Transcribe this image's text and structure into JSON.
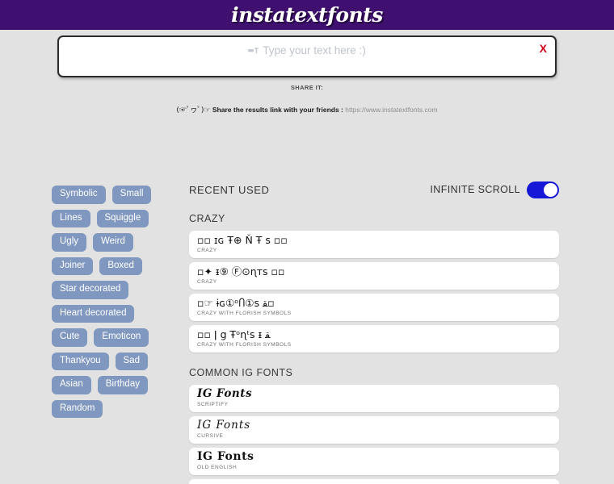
{
  "header": {
    "logo": "instatextfonts",
    "bg_color": "#3f1070"
  },
  "input": {
    "placeholder": "Type your text here :)",
    "value": "",
    "clear_label": "X",
    "clear_color": "#d0021b",
    "icon": "pencil-icon"
  },
  "share": {
    "title": "SHARE IT:",
    "emoticon": "(☞ﾟヮﾟ)☞",
    "message": "Share the results link with your friends :",
    "url": "https://www.instatextfonts.com"
  },
  "sidebar": {
    "tags": [
      {
        "label": "Symbolic"
      },
      {
        "label": "Small"
      },
      {
        "label": "Lines"
      },
      {
        "label": "Squiggle"
      },
      {
        "label": "Ugly"
      },
      {
        "label": "Weird"
      },
      {
        "label": "Joiner"
      },
      {
        "label": "Boxed"
      },
      {
        "label": "Star decorated"
      },
      {
        "label": "Heart decorated"
      },
      {
        "label": "Cute"
      },
      {
        "label": "Emoticon"
      },
      {
        "label": "Thankyou"
      },
      {
        "label": "Sad"
      },
      {
        "label": "Asian"
      },
      {
        "label": "Birthday"
      },
      {
        "label": "Random"
      }
    ],
    "tag_color": "#8098c0"
  },
  "main": {
    "recent_used_label": "RECENT USED",
    "infinite_scroll_label": "INFINITE SCROLL",
    "infinite_scroll_on": true,
    "toggle_color": "#1717d8",
    "groups": [
      {
        "label": "CRAZY",
        "cards": [
          {
            "sample": "▫▫ ɪɢ Ŧ⊕ Ň Ŧ s  ▫▫",
            "tag": "CRAZY",
            "style": "symbol"
          },
          {
            "sample": "▫✦ ᵻ⑨ Ⓕ⊙ɳᴛs ▫▫",
            "tag": "CRAZY",
            "style": "symbol"
          },
          {
            "sample": "▫☞ ɨɢ①ᵒႶ①s ﻘ▫",
            "tag": "CRAZY WITH FLORISH SYMBOLS",
            "style": "symbol"
          },
          {
            "sample": "▫▫ ǀ g Ŧᵒɳᵗs ᵻ ﻘ",
            "tag": "CRAZY WITH FLORISH SYMBOLS",
            "style": "symbol"
          }
        ]
      },
      {
        "label": "COMMON IG FONTS",
        "cards": [
          {
            "sample": "IG Fonts",
            "tag": "SCRIPTIFY",
            "style": "script"
          },
          {
            "sample": "IG Fonts",
            "tag": "CURSIVE",
            "style": "cursive"
          },
          {
            "sample": "IG Fonts",
            "tag": "OLD ENGLISH",
            "style": "oldeng"
          }
        ]
      }
    ]
  }
}
